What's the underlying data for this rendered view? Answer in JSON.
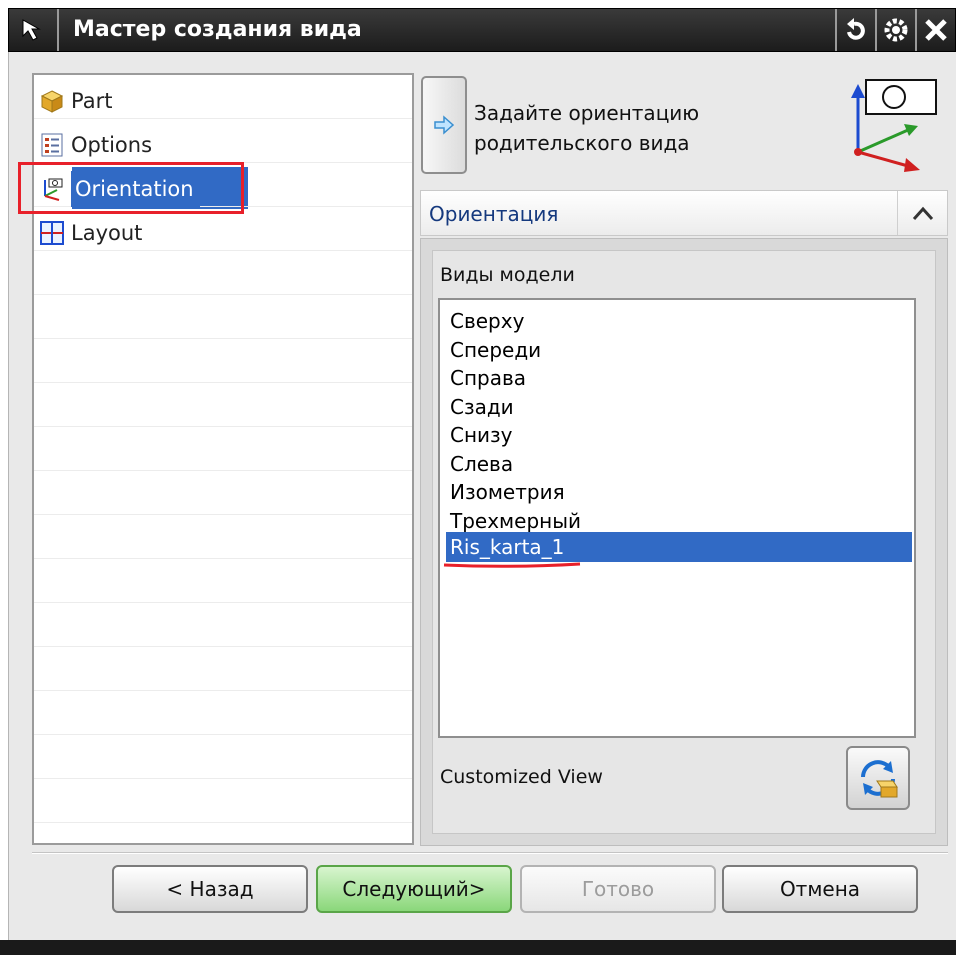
{
  "window": {
    "title": "Мастер создания вида"
  },
  "nav": {
    "items": [
      {
        "label": "Part",
        "icon": "part-cube-icon"
      },
      {
        "label": "Options",
        "icon": "options-checklist-icon"
      },
      {
        "label": "Orientation",
        "icon": "orientation-icon",
        "selected": true
      },
      {
        "label": "Layout",
        "icon": "layout-grid-icon"
      }
    ]
  },
  "step": {
    "instruction_line1": "Задайте ориентацию",
    "instruction_line2": "родительского вида"
  },
  "section": {
    "title": "Ориентация"
  },
  "models": {
    "label": "Виды модели",
    "items": [
      "Сверху",
      "Спереди",
      "Справа",
      "Сзади",
      "Снизу",
      "Слева",
      "Изометрия",
      "Трехмерный",
      "Ris_karta_1"
    ],
    "selected": "Ris_karta_1"
  },
  "customized": {
    "label": "Customized View"
  },
  "buttons": {
    "back": "< Назад",
    "next": "Следующий>",
    "finish": "Готово",
    "cancel": "Отмена"
  },
  "colors": {
    "selection": "#316ac5",
    "highlight_red": "#e8202a",
    "primary_button": "#8ad77a"
  }
}
